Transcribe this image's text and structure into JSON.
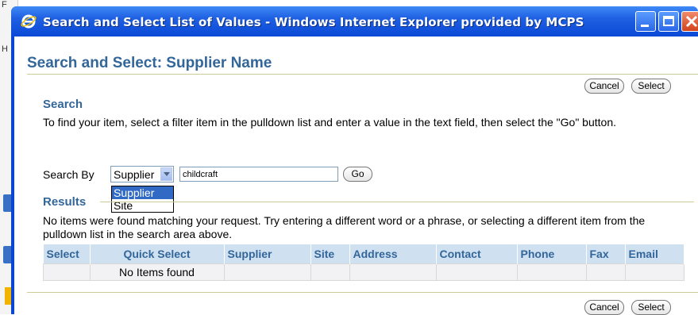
{
  "window": {
    "title": "Search and Select List of Values - Windows Internet Explorer provided by MCPS"
  },
  "page": {
    "title": "Search and Select: Supplier Name"
  },
  "buttons": {
    "cancel": "Cancel",
    "select": "Select",
    "go": "Go"
  },
  "search": {
    "heading": "Search",
    "instructions": "To find your item, select a filter item in the pulldown list and enter a value in the text field, then select the \"Go\" button.",
    "search_by_label": "Search By",
    "selected_option": "Supplier",
    "options": [
      "Supplier",
      "Site"
    ],
    "text_value": "childcraft"
  },
  "results": {
    "heading": "Results",
    "message": "No items were found matching your request. Try entering a different word or a phrase, or selecting a different item from the pulldown list in the search area above.",
    "columns": [
      "Select",
      "Quick Select",
      "Supplier",
      "Site",
      "Address",
      "Contact",
      "Phone",
      "Fax",
      "Email"
    ],
    "empty_text": "No Items found"
  },
  "colors": {
    "heading": "#336699",
    "titlebar": "#0a46d6",
    "table_header": "#cfe0f1"
  }
}
